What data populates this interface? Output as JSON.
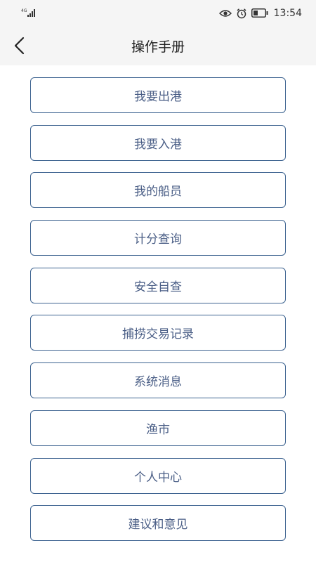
{
  "status_bar": {
    "network": "4G",
    "time": "13:54",
    "icons": [
      "eye-icon",
      "alarm-icon",
      "battery-icon"
    ]
  },
  "header": {
    "back_icon": "chevron-left-icon",
    "title": "操作手册"
  },
  "menu": {
    "items": [
      {
        "label": "我要出港"
      },
      {
        "label": "我要入港"
      },
      {
        "label": "我的船员"
      },
      {
        "label": "计分查询"
      },
      {
        "label": "安全自查"
      },
      {
        "label": "捕捞交易记录"
      },
      {
        "label": "系统消息"
      },
      {
        "label": "渔市"
      },
      {
        "label": "个人中心"
      },
      {
        "label": "建议和意见"
      }
    ]
  },
  "colors": {
    "button_border": "#3d6390",
    "button_text": "#4a5e86",
    "header_bg": "#f5f5f5"
  }
}
